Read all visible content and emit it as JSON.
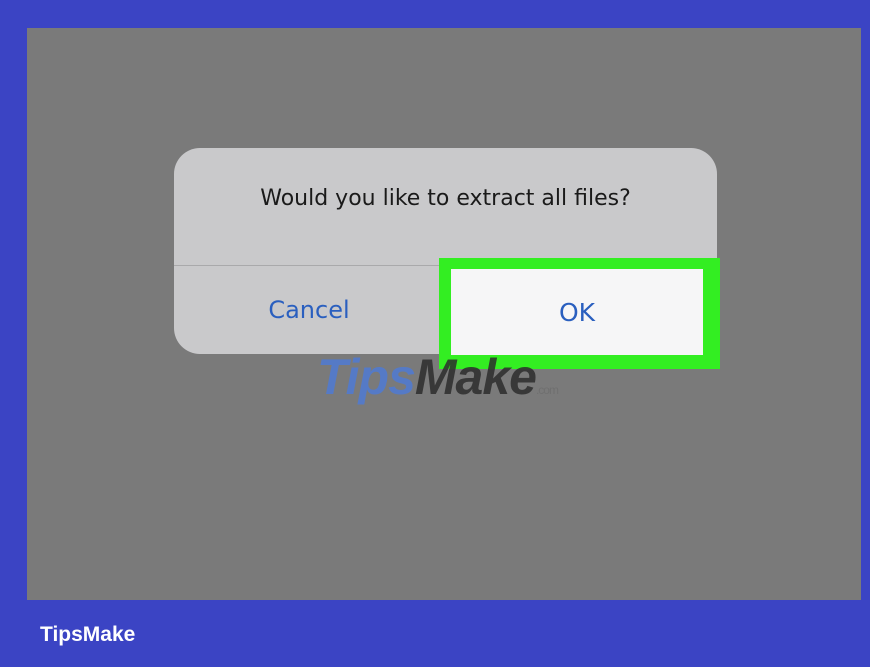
{
  "alert": {
    "message": "Would you like to extract all files?",
    "cancel_label": "Cancel",
    "ok_label": "OK"
  },
  "watermark": {
    "part1": "Tips",
    "part2": "Make",
    "suffix": ".com"
  },
  "footer": {
    "brand": "TipsMake"
  },
  "colors": {
    "frame": "#3b44c4",
    "screen": "#7a7a7a",
    "alert_bg": "#c9c9cb",
    "highlight": "#33ee22",
    "button_text": "#2a5fbf"
  }
}
